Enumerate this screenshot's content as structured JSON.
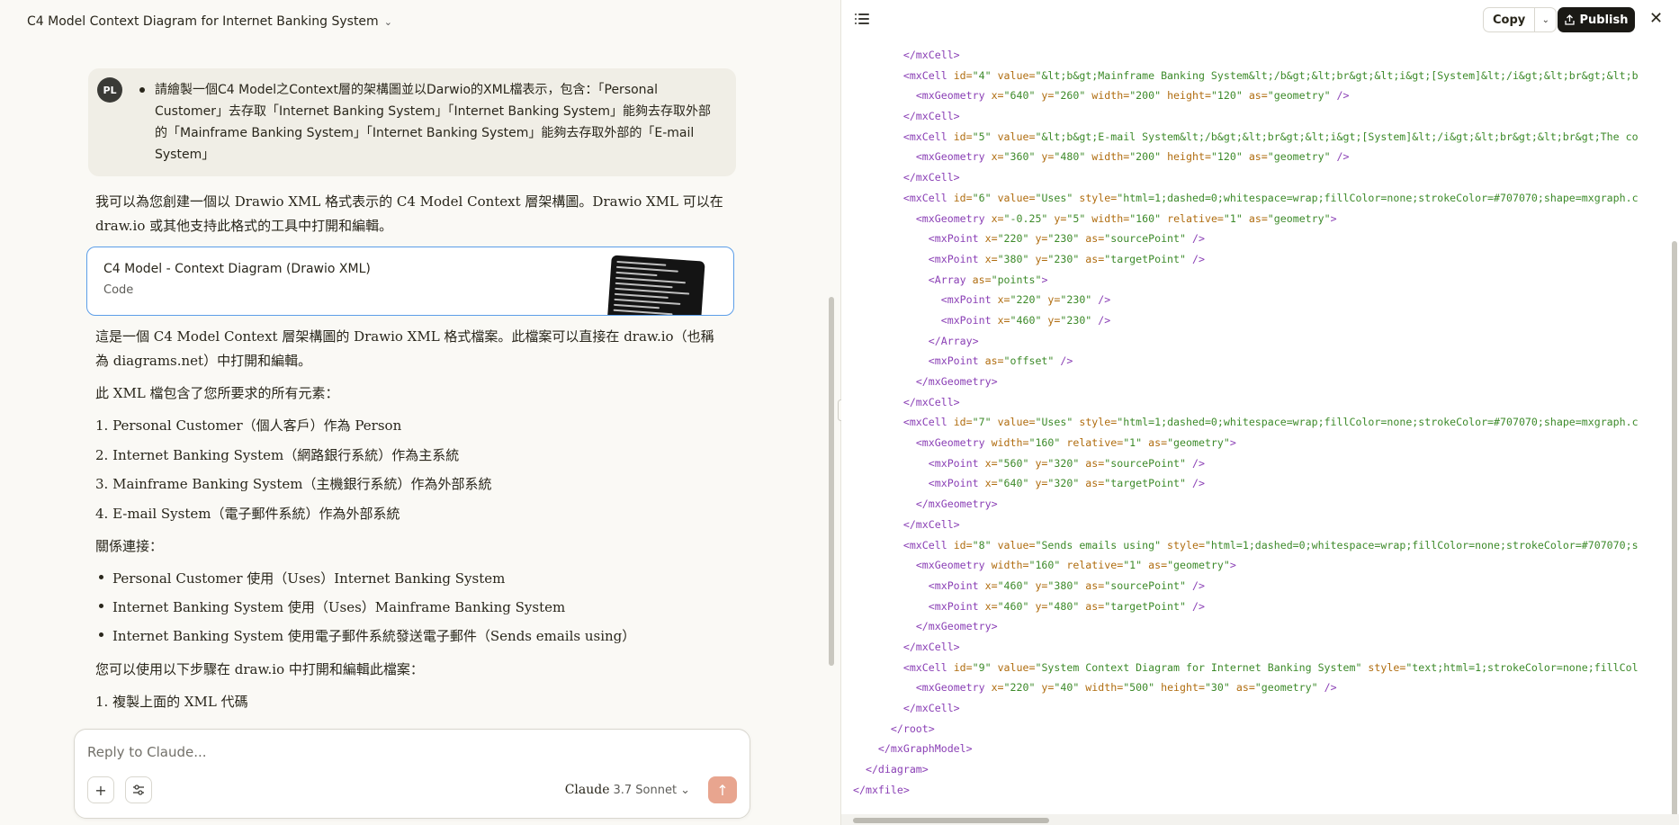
{
  "conversation": {
    "title": "C4 Model Context Diagram for Internet Banking System"
  },
  "user_message": {
    "avatar_initials": "PL",
    "text": "請繪製一個C4 Model之Context層的架構圖並以Darwio的XML檔表示，包含：「Personal Customer」去存取「Internet Banking System」「Internet Banking System」能夠去存取外部的「Mainframe Banking System」「Internet Banking System」能夠去存取外部的「E-mail System」"
  },
  "response": {
    "intro": "我可以為您創建一個以 Drawio XML 格式表示的 C4 Model Context 層架構圖。Drawio XML 可以在 draw.io 或其他支持此格式的工具中打開和編輯。",
    "artifact": {
      "title": "C4 Model - Context Diagram (Drawio XML)",
      "subtitle": "Code"
    },
    "para2": "這是一個 C4 Model Context 層架構圖的 Drawio XML 格式檔案。此檔案可以直接在 draw.io（也稱為 diagrams.net）中打開和編輯。",
    "para3": "此 XML 檔包含了您所要求的所有元素：",
    "elements": [
      "1. Personal Customer（個人客戶）作為 Person",
      "2. Internet Banking System（網路銀行系統）作為主系統",
      "3. Mainframe Banking System（主機銀行系統）作為外部系統",
      "4. E-mail System（電子郵件系統）作為外部系統"
    ],
    "relations_heading": "關係連接：",
    "relations": [
      "Personal Customer 使用（Uses）Internet Banking System",
      "Internet Banking System 使用（Uses）Mainframe Banking System",
      "Internet Banking System 使用電子郵件系統發送電子郵件（Sends emails using）"
    ],
    "steps_heading": "您可以使用以下步驟在 draw.io 中打開和編輯此檔案：",
    "steps": [
      "1. 複製上面的 XML 代碼"
    ]
  },
  "composer": {
    "placeholder": "Reply to Claude...",
    "model_name": "Claude",
    "model_version": "3.7 Sonnet"
  },
  "code_panel": {
    "copy_label": "Copy",
    "publish_label": "Publish",
    "lines": [
      {
        "indent": 4,
        "parts": [
          [
            "t",
            "</mxCell>"
          ]
        ]
      },
      {
        "indent": 4,
        "parts": [
          [
            "t",
            "<mxCell "
          ],
          [
            "a",
            "id="
          ],
          [
            "s",
            "\"4\""
          ],
          [
            "a",
            " value="
          ],
          [
            "s",
            "\"&lt;b&gt;Mainframe Banking System&lt;/b&gt;&lt;br&gt;&lt;i&gt;[System]&lt;/i&gt;&lt;br&gt;&lt;b"
          ]
        ]
      },
      {
        "indent": 5,
        "parts": [
          [
            "t",
            "<mxGeometry "
          ],
          [
            "a",
            "x="
          ],
          [
            "s",
            "\"640\""
          ],
          [
            "a",
            " y="
          ],
          [
            "s",
            "\"260\""
          ],
          [
            "a",
            " width="
          ],
          [
            "s",
            "\"200\""
          ],
          [
            "a",
            " height="
          ],
          [
            "s",
            "\"120\""
          ],
          [
            "a",
            " as="
          ],
          [
            "s",
            "\"geometry\""
          ],
          [
            "t",
            " />"
          ]
        ]
      },
      {
        "indent": 4,
        "parts": [
          [
            "t",
            "</mxCell>"
          ]
        ]
      },
      {
        "indent": 4,
        "parts": [
          [
            "t",
            "<mxCell "
          ],
          [
            "a",
            "id="
          ],
          [
            "s",
            "\"5\""
          ],
          [
            "a",
            " value="
          ],
          [
            "s",
            "\"&lt;b&gt;E-mail System&lt;/b&gt;&lt;br&gt;&lt;i&gt;[System]&lt;/i&gt;&lt;br&gt;&lt;br&gt;The co"
          ]
        ]
      },
      {
        "indent": 5,
        "parts": [
          [
            "t",
            "<mxGeometry "
          ],
          [
            "a",
            "x="
          ],
          [
            "s",
            "\"360\""
          ],
          [
            "a",
            " y="
          ],
          [
            "s",
            "\"480\""
          ],
          [
            "a",
            " width="
          ],
          [
            "s",
            "\"200\""
          ],
          [
            "a",
            " height="
          ],
          [
            "s",
            "\"120\""
          ],
          [
            "a",
            " as="
          ],
          [
            "s",
            "\"geometry\""
          ],
          [
            "t",
            " />"
          ]
        ]
      },
      {
        "indent": 4,
        "parts": [
          [
            "t",
            "</mxCell>"
          ]
        ]
      },
      {
        "indent": 4,
        "parts": [
          [
            "t",
            "<mxCell "
          ],
          [
            "a",
            "id="
          ],
          [
            "s",
            "\"6\""
          ],
          [
            "a",
            " value="
          ],
          [
            "s",
            "\"Uses\""
          ],
          [
            "a",
            " style="
          ],
          [
            "s",
            "\"html=1;dashed=0;whitespace=wrap;fillColor=none;strokeColor=#707070;shape=mxgraph.c"
          ]
        ]
      },
      {
        "indent": 5,
        "parts": [
          [
            "t",
            "<mxGeometry "
          ],
          [
            "a",
            "x="
          ],
          [
            "s",
            "\"-0.25\""
          ],
          [
            "a",
            " y="
          ],
          [
            "s",
            "\"5\""
          ],
          [
            "a",
            " width="
          ],
          [
            "s",
            "\"160\""
          ],
          [
            "a",
            " relative="
          ],
          [
            "s",
            "\"1\""
          ],
          [
            "a",
            " as="
          ],
          [
            "s",
            "\"geometry\""
          ],
          [
            "t",
            ">"
          ]
        ]
      },
      {
        "indent": 6,
        "parts": [
          [
            "t",
            "<mxPoint "
          ],
          [
            "a",
            "x="
          ],
          [
            "s",
            "\"220\""
          ],
          [
            "a",
            " y="
          ],
          [
            "s",
            "\"230\""
          ],
          [
            "a",
            " as="
          ],
          [
            "s",
            "\"sourcePoint\""
          ],
          [
            "t",
            " />"
          ]
        ]
      },
      {
        "indent": 6,
        "parts": [
          [
            "t",
            "<mxPoint "
          ],
          [
            "a",
            "x="
          ],
          [
            "s",
            "\"380\""
          ],
          [
            "a",
            " y="
          ],
          [
            "s",
            "\"230\""
          ],
          [
            "a",
            " as="
          ],
          [
            "s",
            "\"targetPoint\""
          ],
          [
            "t",
            " />"
          ]
        ]
      },
      {
        "indent": 6,
        "parts": [
          [
            "t",
            "<Array "
          ],
          [
            "a",
            "as="
          ],
          [
            "s",
            "\"points\""
          ],
          [
            "t",
            ">"
          ]
        ]
      },
      {
        "indent": 7,
        "parts": [
          [
            "t",
            "<mxPoint "
          ],
          [
            "a",
            "x="
          ],
          [
            "s",
            "\"220\""
          ],
          [
            "a",
            " y="
          ],
          [
            "s",
            "\"230\""
          ],
          [
            "t",
            " />"
          ]
        ]
      },
      {
        "indent": 7,
        "parts": [
          [
            "t",
            "<mxPoint "
          ],
          [
            "a",
            "x="
          ],
          [
            "s",
            "\"460\""
          ],
          [
            "a",
            " y="
          ],
          [
            "s",
            "\"230\""
          ],
          [
            "t",
            " />"
          ]
        ]
      },
      {
        "indent": 6,
        "parts": [
          [
            "t",
            "</Array>"
          ]
        ]
      },
      {
        "indent": 6,
        "parts": [
          [
            "t",
            "<mxPoint "
          ],
          [
            "a",
            "as="
          ],
          [
            "s",
            "\"offset\""
          ],
          [
            "t",
            " />"
          ]
        ]
      },
      {
        "indent": 5,
        "parts": [
          [
            "t",
            "</mxGeometry>"
          ]
        ]
      },
      {
        "indent": 4,
        "parts": [
          [
            "t",
            "</mxCell>"
          ]
        ]
      },
      {
        "indent": 4,
        "parts": [
          [
            "t",
            "<mxCell "
          ],
          [
            "a",
            "id="
          ],
          [
            "s",
            "\"7\""
          ],
          [
            "a",
            " value="
          ],
          [
            "s",
            "\"Uses\""
          ],
          [
            "a",
            " style="
          ],
          [
            "s",
            "\"html=1;dashed=0;whitespace=wrap;fillColor=none;strokeColor=#707070;shape=mxgraph.c"
          ]
        ]
      },
      {
        "indent": 5,
        "parts": [
          [
            "t",
            "<mxGeometry "
          ],
          [
            "a",
            "width="
          ],
          [
            "s",
            "\"160\""
          ],
          [
            "a",
            " relative="
          ],
          [
            "s",
            "\"1\""
          ],
          [
            "a",
            " as="
          ],
          [
            "s",
            "\"geometry\""
          ],
          [
            "t",
            ">"
          ]
        ]
      },
      {
        "indent": 6,
        "parts": [
          [
            "t",
            "<mxPoint "
          ],
          [
            "a",
            "x="
          ],
          [
            "s",
            "\"560\""
          ],
          [
            "a",
            " y="
          ],
          [
            "s",
            "\"320\""
          ],
          [
            "a",
            " as="
          ],
          [
            "s",
            "\"sourcePoint\""
          ],
          [
            "t",
            " />"
          ]
        ]
      },
      {
        "indent": 6,
        "parts": [
          [
            "t",
            "<mxPoint "
          ],
          [
            "a",
            "x="
          ],
          [
            "s",
            "\"640\""
          ],
          [
            "a",
            " y="
          ],
          [
            "s",
            "\"320\""
          ],
          [
            "a",
            " as="
          ],
          [
            "s",
            "\"targetPoint\""
          ],
          [
            "t",
            " />"
          ]
        ]
      },
      {
        "indent": 5,
        "parts": [
          [
            "t",
            "</mxGeometry>"
          ]
        ]
      },
      {
        "indent": 4,
        "parts": [
          [
            "t",
            "</mxCell>"
          ]
        ]
      },
      {
        "indent": 4,
        "parts": [
          [
            "t",
            "<mxCell "
          ],
          [
            "a",
            "id="
          ],
          [
            "s",
            "\"8\""
          ],
          [
            "a",
            " value="
          ],
          [
            "s",
            "\"Sends emails using\""
          ],
          [
            "a",
            " style="
          ],
          [
            "s",
            "\"html=1;dashed=0;whitespace=wrap;fillColor=none;strokeColor=#707070;s"
          ]
        ]
      },
      {
        "indent": 5,
        "parts": [
          [
            "t",
            "<mxGeometry "
          ],
          [
            "a",
            "width="
          ],
          [
            "s",
            "\"160\""
          ],
          [
            "a",
            " relative="
          ],
          [
            "s",
            "\"1\""
          ],
          [
            "a",
            " as="
          ],
          [
            "s",
            "\"geometry\""
          ],
          [
            "t",
            ">"
          ]
        ]
      },
      {
        "indent": 6,
        "parts": [
          [
            "t",
            "<mxPoint "
          ],
          [
            "a",
            "x="
          ],
          [
            "s",
            "\"460\""
          ],
          [
            "a",
            " y="
          ],
          [
            "s",
            "\"380\""
          ],
          [
            "a",
            " as="
          ],
          [
            "s",
            "\"sourcePoint\""
          ],
          [
            "t",
            " />"
          ]
        ]
      },
      {
        "indent": 6,
        "parts": [
          [
            "t",
            "<mxPoint "
          ],
          [
            "a",
            "x="
          ],
          [
            "s",
            "\"460\""
          ],
          [
            "a",
            " y="
          ],
          [
            "s",
            "\"480\""
          ],
          [
            "a",
            " as="
          ],
          [
            "s",
            "\"targetPoint\""
          ],
          [
            "t",
            " />"
          ]
        ]
      },
      {
        "indent": 5,
        "parts": [
          [
            "t",
            "</mxGeometry>"
          ]
        ]
      },
      {
        "indent": 4,
        "parts": [
          [
            "t",
            "</mxCell>"
          ]
        ]
      },
      {
        "indent": 4,
        "parts": [
          [
            "t",
            "<mxCell "
          ],
          [
            "a",
            "id="
          ],
          [
            "s",
            "\"9\""
          ],
          [
            "a",
            " value="
          ],
          [
            "s",
            "\"System Context Diagram for Internet Banking System\""
          ],
          [
            "a",
            " style="
          ],
          [
            "s",
            "\"text;html=1;strokeColor=none;fillCol"
          ]
        ]
      },
      {
        "indent": 5,
        "parts": [
          [
            "t",
            "<mxGeometry "
          ],
          [
            "a",
            "x="
          ],
          [
            "s",
            "\"220\""
          ],
          [
            "a",
            " y="
          ],
          [
            "s",
            "\"40\""
          ],
          [
            "a",
            " width="
          ],
          [
            "s",
            "\"500\""
          ],
          [
            "a",
            " height="
          ],
          [
            "s",
            "\"30\""
          ],
          [
            "a",
            " as="
          ],
          [
            "s",
            "\"geometry\""
          ],
          [
            "t",
            " />"
          ]
        ]
      },
      {
        "indent": 4,
        "parts": [
          [
            "t",
            "</mxCell>"
          ]
        ]
      },
      {
        "indent": 3,
        "parts": [
          [
            "t",
            "</root>"
          ]
        ]
      },
      {
        "indent": 2,
        "parts": [
          [
            "t",
            "</mxGraphModel>"
          ]
        ]
      },
      {
        "indent": 1,
        "parts": [
          [
            "t",
            "</diagram>"
          ]
        ]
      },
      {
        "indent": 0,
        "parts": [
          [
            "t",
            "</mxfile>"
          ]
        ]
      }
    ]
  }
}
